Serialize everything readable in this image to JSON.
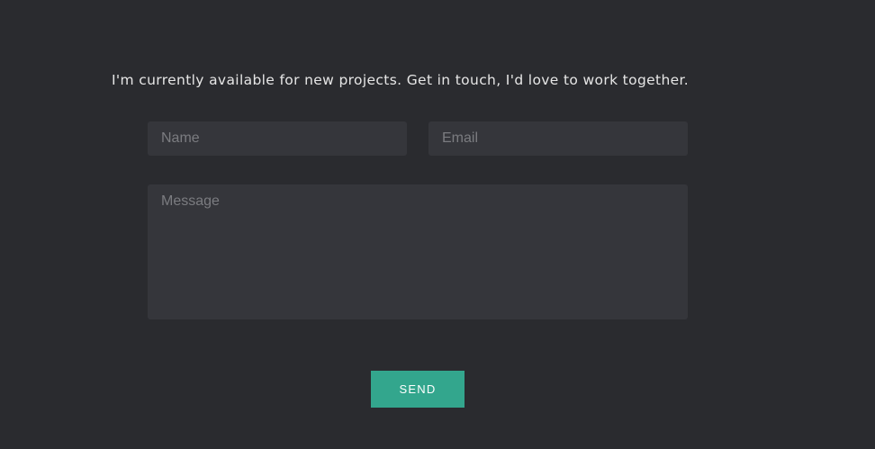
{
  "contact": {
    "intro_text": "I'm currently available for new projects. Get in touch, I'd love to work together.",
    "name_placeholder": "Name",
    "email_placeholder": "Email",
    "message_placeholder": "Message",
    "send_label": "SEND"
  },
  "colors": {
    "background": "#2a2b2f",
    "field_background": "#35363b",
    "accent": "#33a68d",
    "text": "#e6e6e6",
    "placeholder": "#7b7c80"
  }
}
